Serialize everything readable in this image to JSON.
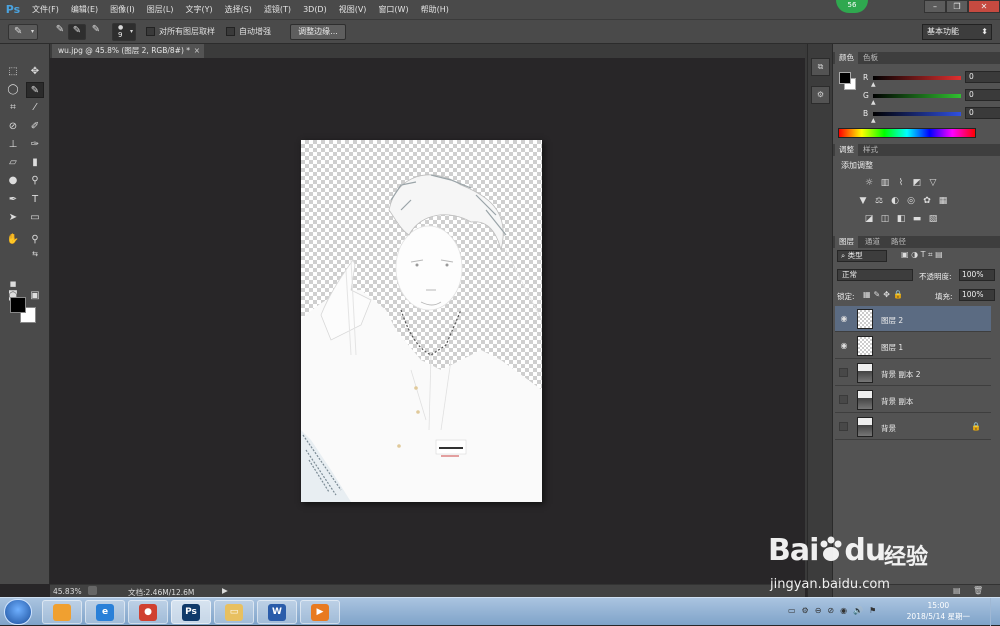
{
  "app": {
    "logo": "Ps"
  },
  "menu": [
    "文件(F)",
    "编辑(E)",
    "图像(I)",
    "图层(L)",
    "文字(Y)",
    "选择(S)",
    "滤镜(T)",
    "3D(D)",
    "视图(V)",
    "窗口(W)",
    "帮助(H)"
  ],
  "badge": "56",
  "options": {
    "brush_size": "9",
    "sample_all_layers": "对所有图层取样",
    "auto_enhance": "自动增强",
    "refine_edge": "调整边缘...",
    "workspace": "基本功能"
  },
  "document": {
    "tab_title": "wu.jpg @ 45.8% (图层 2, RGB/8#) *",
    "close": "×"
  },
  "status": {
    "zoom": "45.83%",
    "doc_size": "文档:2.46M/12.6M"
  },
  "color_panel": {
    "tabs": [
      "颜色",
      "色板"
    ],
    "rows": [
      {
        "label": "R",
        "value": "0",
        "color": "#e03030"
      },
      {
        "label": "G",
        "value": "0",
        "color": "#30c030"
      },
      {
        "label": "B",
        "value": "0",
        "color": "#3050e0"
      }
    ]
  },
  "adjust_panel": {
    "tabs": [
      "调整",
      "样式"
    ],
    "title": "添加调整",
    "row1": [
      "sun-icon",
      "levels-icon",
      "curves-icon",
      "exposure-icon",
      "triangle-icon"
    ],
    "row2": [
      "vibrance-icon",
      "balance-icon",
      "bw-icon",
      "photo-filter-icon",
      "channel-mixer-icon",
      "grid-icon"
    ],
    "row3": [
      "invert-icon",
      "posterize-icon",
      "threshold-icon",
      "gradient-map-icon",
      "selective-color-icon"
    ]
  },
  "layers_panel": {
    "tabs": [
      "图层",
      "通道",
      "路径"
    ],
    "filter": "类型",
    "blend_mode": "正常",
    "opacity_label": "不透明度:",
    "opacity": "100%",
    "lock_label": "锁定:",
    "fill_label": "填充:",
    "fill": "100%",
    "layers": [
      {
        "name": "图层 2",
        "visible": true,
        "selected": true,
        "thumb": "checker"
      },
      {
        "name": "图层 1",
        "visible": true,
        "selected": false,
        "thumb": "checker"
      },
      {
        "name": "背景 副本 2",
        "visible": false,
        "selected": false,
        "thumb": "photo"
      },
      {
        "name": "背景 副本",
        "visible": false,
        "selected": false,
        "thumb": "photo"
      },
      {
        "name": "背景",
        "visible": false,
        "selected": false,
        "thumb": "photo",
        "locked": true
      }
    ]
  },
  "taskbar": {
    "time": "15:00",
    "date": "2018/5/14 星期一",
    "apps": [
      {
        "name": "windows-explorer-icon",
        "glyph": "",
        "color": "#f0a030"
      },
      {
        "name": "ie-icon",
        "glyph": "e",
        "color": "#2a80d8"
      },
      {
        "name": "chrome-icon",
        "glyph": "●",
        "color": "#d04030"
      },
      {
        "name": "photoshop-icon",
        "glyph": "Ps",
        "color": "#103a6a"
      },
      {
        "name": "folder-icon",
        "glyph": "▭",
        "color": "#e8c060"
      },
      {
        "name": "word-icon",
        "glyph": "W",
        "color": "#2a5caa"
      },
      {
        "name": "media-player-icon",
        "glyph": "▶",
        "color": "#e87a20"
      }
    ]
  },
  "watermark": {
    "brand": "Bai",
    "paw": "du",
    "cn": "经验",
    "url": "jingyan.baidu.com"
  }
}
